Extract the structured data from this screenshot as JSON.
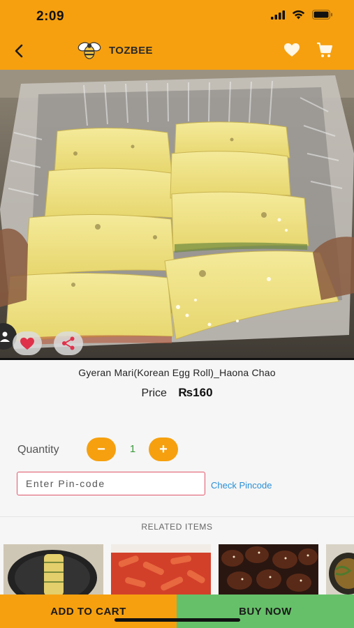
{
  "status_bar": {
    "time": "2:09"
  },
  "header": {
    "brand_name": "TOZBEE",
    "back_icon": "chevron-left-icon",
    "logo_icon": "bee-icon",
    "wishlist_icon": "heart-icon",
    "cart_icon": "cart-icon",
    "color": "#f6a00f"
  },
  "product": {
    "name": "Gyeran Mari(Korean Egg Roll)_Haona Chao",
    "price_label": "Price",
    "price_value": "₨160",
    "image_subject": "korean-egg-roll-photo"
  },
  "image_actions": {
    "favorite_icon": "heart-icon",
    "share_icon": "share-icon",
    "user_icon": "user-icon"
  },
  "quantity": {
    "label": "Quantity",
    "minus": "−",
    "value": "1",
    "plus": "+"
  },
  "pincode": {
    "placeholder": "Enter Pin-code",
    "value": "",
    "check_label": "Check Pincode"
  },
  "related": {
    "title": "RELATED ITEMS",
    "items": [
      {
        "image": "egg-roll-plate-photo"
      },
      {
        "image": "tteokbokki-photo"
      },
      {
        "image": "sesame-chicken-photo"
      },
      {
        "image": "noodle-bowl-photo"
      }
    ]
  },
  "actions": {
    "add_to_cart": "ADD TO CART",
    "buy_now": "BUY NOW",
    "add_to_cart_color": "#f6a00f",
    "buy_now_color": "#66c069"
  }
}
